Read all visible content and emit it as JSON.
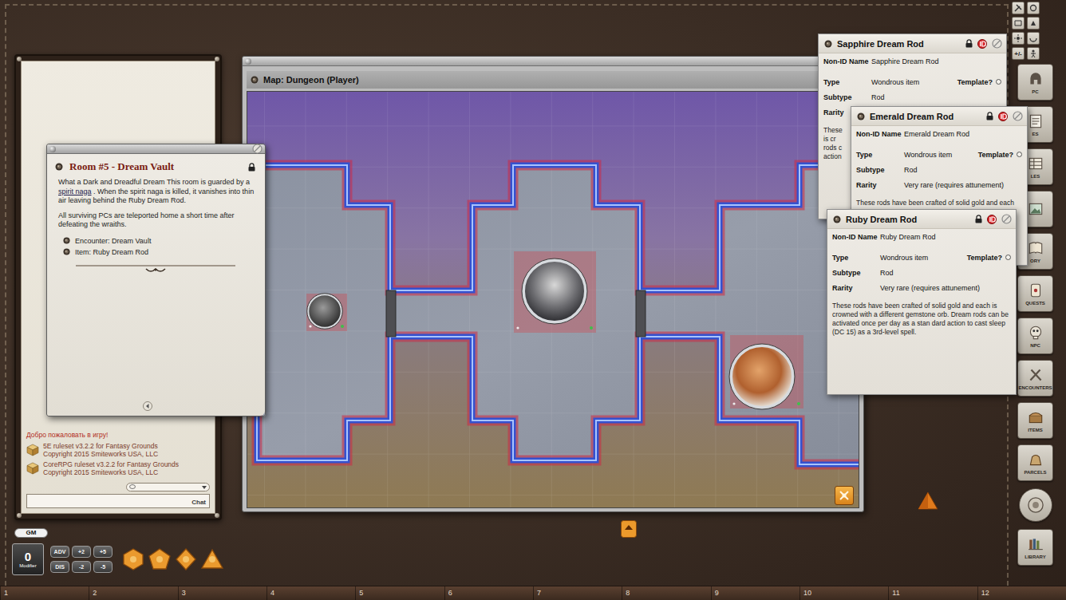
{
  "chat": {
    "messages": [
      {
        "kind": "notice",
        "text": "Добро пожаловать в игру!"
      },
      {
        "kind": "ruleset",
        "text": "5E ruleset v3.2.2 for Fantasy Grounds",
        "sub": "Copyright 2015 Smiteworks USA, LLC"
      },
      {
        "kind": "ruleset",
        "text": "CoreRPG ruleset v3.2.2 for Fantasy Grounds",
        "sub": "Copyright 2015 Smiteworks USA, LLC"
      }
    ],
    "input_label": "Chat"
  },
  "story": {
    "title": "Room #5 - Dream Vault",
    "paragraphs": [
      [
        {
          "text": "What a Dark and Dreadful Dream This room is guarded by a ",
          "link": false
        },
        {
          "text": "spirit naga",
          "link": true
        },
        {
          "text": " . When the spirit naga is killed, it vanishes into thin air leaving behind the Ruby Dream Rod.",
          "link": false
        }
      ],
      [
        {
          "text": "All surviving PCs are teleported home a short time after defeating the wraiths.",
          "link": false
        }
      ]
    ],
    "links": [
      "Encounter: Dream Vault",
      "Item: Ruby Dream Rod"
    ]
  },
  "map": {
    "title": "Map: Dungeon (Player)",
    "tokens": [
      {
        "kind": "medium"
      },
      {
        "kind": "large"
      },
      {
        "kind": "large"
      }
    ]
  },
  "items": [
    {
      "title": "Sapphire Dream Rod",
      "kind": "covered",
      "template_checked": false,
      "fields": [
        {
          "label": "Non-ID Name",
          "value": "Sapphire Dream Rod"
        },
        {
          "label": "Type",
          "value": "Wondrous item",
          "extra": "Template?"
        },
        {
          "label": "Subtype",
          "value": "Rod"
        },
        {
          "label": "Rarity"
        }
      ],
      "description": [
        "These",
        "is cr",
        "rods c",
        "action"
      ]
    },
    {
      "title": "Emerald Dream Rod",
      "kind": "covered",
      "template_checked": false,
      "fields": [
        {
          "label": "Non-ID Name",
          "value": "Emerald Dream Rod"
        },
        {
          "label": "Type",
          "value": "Wondrous item",
          "extra": "Template?"
        },
        {
          "label": "Subtype",
          "value": "Rod"
        },
        {
          "label": "Rarity",
          "value": "Very rare (requires attunement)"
        }
      ],
      "description": [
        "These rods have been crafted of solid gold and each"
      ]
    },
    {
      "title": "Ruby Dream Rod",
      "kind": "front",
      "template_checked": false,
      "fields": [
        {
          "label": "Non-ID Name",
          "value": "Ruby Dream Rod"
        },
        {
          "label": "Type",
          "value": "Wondrous item",
          "extra": "Template?"
        },
        {
          "label": "Subtype",
          "value": "Rod"
        },
        {
          "label": "Rarity",
          "value": "Very rare (requires attunement)"
        }
      ],
      "description": [
        "These rods have been crafted of solid gold and each is crowned with a different gemstone orb. Dream rods can be activated once per day as a stan dard action to cast sleep (DC 15) as a 3rd-level spell."
      ]
    }
  ],
  "toolbar": [
    {
      "kind": "icon"
    },
    {
      "kind": "icon"
    },
    {
      "kind": "icon"
    },
    {
      "kind": "icon"
    },
    {
      "kind": "icon"
    },
    {
      "kind": "icon"
    },
    {
      "kind": "text",
      "label": "+/-"
    },
    {
      "kind": "icon"
    }
  ],
  "sidebar": [
    {
      "kind": "tab",
      "label": "PC"
    },
    {
      "kind": "tab",
      "label": "ES"
    },
    {
      "kind": "tab",
      "label": "LES"
    },
    {
      "kind": "tab"
    },
    {
      "kind": "tab",
      "label": "ORY"
    },
    {
      "kind": "tab",
      "label": "QUESTS"
    },
    {
      "kind": "tab",
      "label": "NPC"
    },
    {
      "kind": "tab",
      "label": "ENCOUNTERS"
    },
    {
      "kind": "tab",
      "label": "ITEMS"
    },
    {
      "kind": "tab",
      "label": "PARCELS"
    },
    {
      "kind": "round"
    },
    {
      "kind": "tab",
      "label": "LIBRARY"
    }
  ],
  "dice_tray": {
    "user": "GM",
    "modifier": "0",
    "modifier_label": "Modifier",
    "buttons": [
      "ADV",
      "+2",
      "+5",
      "DIS",
      "-2",
      "-5"
    ],
    "dice": [
      {
        "kind": "d20"
      },
      {
        "kind": "d12"
      },
      {
        "kind": "d8"
      },
      {
        "kind": "d4"
      }
    ]
  },
  "hotkeys": [
    "1",
    "2",
    "3",
    "4",
    "5",
    "6",
    "7",
    "8",
    "9",
    "10",
    "11",
    "12"
  ]
}
